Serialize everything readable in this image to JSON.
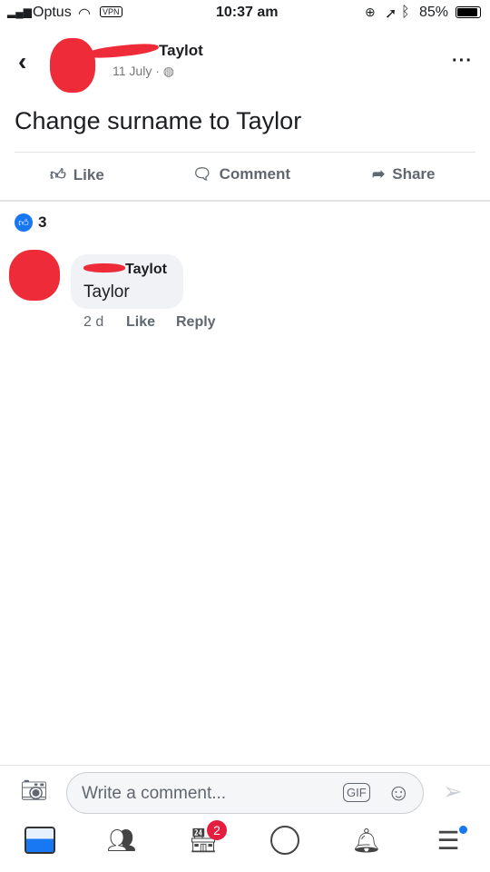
{
  "status_bar": {
    "carrier": "Optus",
    "vpn": "VPN",
    "time": "10:37 am",
    "battery": "85%",
    "battery_level": 0.85
  },
  "post": {
    "author": "Taylot",
    "date": "11 July",
    "separator": "·",
    "text": "Change surname to Taylor"
  },
  "actions": {
    "like": "Like",
    "comment": "Comment",
    "share": "Share"
  },
  "reactions": {
    "count": "3"
  },
  "comment": {
    "author": "Taylot",
    "text": "Taylor",
    "age": "2 d",
    "like": "Like",
    "reply": "Reply"
  },
  "composer": {
    "placeholder": "Write a comment...",
    "gif": "GIF"
  },
  "bottom_nav": {
    "marketplace_badge": "2"
  },
  "colors": {
    "accent": "#1877f2",
    "badge": "#e41e3f"
  }
}
